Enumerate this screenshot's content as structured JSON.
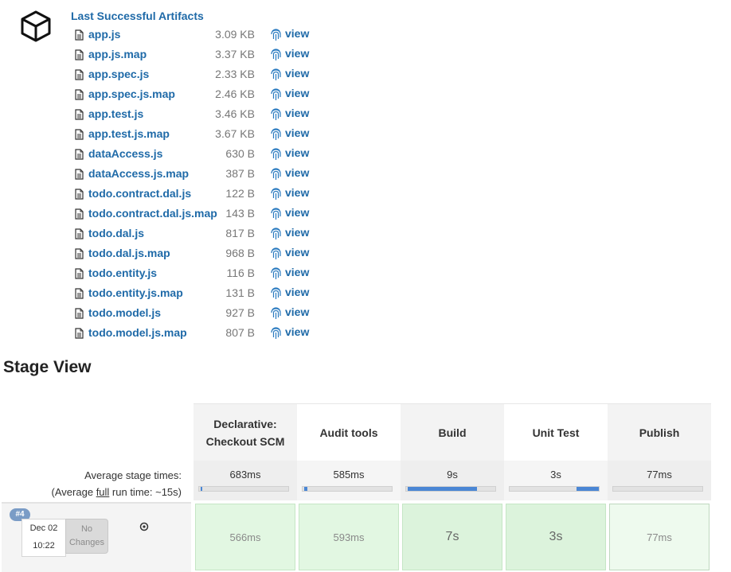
{
  "artifacts": {
    "title": "Last Successful Artifacts",
    "view_label": "view",
    "files": [
      {
        "name": "app.js",
        "size": "3.09 KB"
      },
      {
        "name": "app.js.map",
        "size": "3.37 KB"
      },
      {
        "name": "app.spec.js",
        "size": "2.33 KB"
      },
      {
        "name": "app.spec.js.map",
        "size": "2.46 KB"
      },
      {
        "name": "app.test.js",
        "size": "3.46 KB"
      },
      {
        "name": "app.test.js.map",
        "size": "3.67 KB"
      },
      {
        "name": "dataAccess.js",
        "size": "630 B"
      },
      {
        "name": "dataAccess.js.map",
        "size": "387 B"
      },
      {
        "name": "todo.contract.dal.js",
        "size": "122 B"
      },
      {
        "name": "todo.contract.dal.js.map",
        "size": "143 B"
      },
      {
        "name": "todo.dal.js",
        "size": "817 B"
      },
      {
        "name": "todo.dal.js.map",
        "size": "968 B"
      },
      {
        "name": "todo.entity.js",
        "size": "116 B"
      },
      {
        "name": "todo.entity.js.map",
        "size": "131 B"
      },
      {
        "name": "todo.model.js",
        "size": "927 B"
      },
      {
        "name": "todo.model.js.map",
        "size": "807 B"
      }
    ]
  },
  "stage_view": {
    "heading": "Stage View",
    "avg_label": "Average stage times:",
    "avg_full_prefix": "(Average ",
    "avg_full_word": "full",
    "avg_full_suffix": " run time: ~15s)",
    "stages": [
      {
        "name_line1": "Declarative:",
        "name_line2": "Checkout SCM",
        "avg": "683ms",
        "run_time": "566ms",
        "bar_fraction": 0.02
      },
      {
        "name_line1": "Audit tools",
        "name_line2": "",
        "avg": "585ms",
        "run_time": "593ms",
        "bar_fraction": 0.04
      },
      {
        "name_line1": "Build",
        "name_line2": "",
        "avg": "9s",
        "run_time": "7s",
        "bar_fraction": 0.78
      },
      {
        "name_line1": "Unit Test",
        "name_line2": "",
        "avg": "3s",
        "run_time": "3s",
        "bar_fraction": 0.25
      },
      {
        "name_line1": "Publish",
        "name_line2": "",
        "avg": "77ms",
        "run_time": "77ms",
        "bar_fraction": 0.0
      }
    ],
    "run": {
      "badge": "#4",
      "date": "Dec 02",
      "time": "10:22",
      "changes_line1": "No",
      "changes_line2": "Changes"
    }
  }
}
